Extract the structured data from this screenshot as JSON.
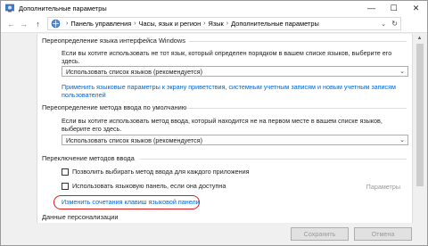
{
  "window": {
    "title": "Дополнительные параметры",
    "minimize": "—",
    "maximize": "☐",
    "close": "✕"
  },
  "nav": {
    "back": "←",
    "forward": "→",
    "up": "↑",
    "breadcrumb": [
      "Панель управления",
      "Часы, язык и регион",
      "Язык",
      "Дополнительные параметры"
    ],
    "separator": "›",
    "dropdown": "⌄",
    "refresh": "↻"
  },
  "sections": {
    "display_language": {
      "title": "Переопределение языка интерфейса Windows",
      "description": "Если вы хотите использовать не тот язык, который определен порядком в вашем списке языков, выберите его здесь.",
      "select_value": "Использовать список языков (рекомендуется)",
      "link": "Применить языковые параметры к экрану приветствия, системным учетным записям и новым учетным записям пользователей"
    },
    "input_method": {
      "title": "Переопределение метода ввода по умолчанию",
      "description": "Если вы хотите использовать метод ввода, который находится не на первом месте в вашем списке языков, выберите его здесь.",
      "select_value": "Использовать список языков (рекомендуется)"
    },
    "switching": {
      "title": "Переключение методов ввода",
      "option1": "Позволить выбирать метод ввода для каждого приложения",
      "option2": "Использовать языковую панель, если она доступна",
      "params_link": "Параметры",
      "hotkeys_link": "Изменить сочетания клавиш языковой панели"
    },
    "personalization": {
      "title": "Данные персонализации"
    }
  },
  "footer": {
    "save": "Сохранить",
    "cancel": "Отмена"
  },
  "colors": {
    "link": "#0066cc",
    "highlight_red": "#e01b1b"
  }
}
